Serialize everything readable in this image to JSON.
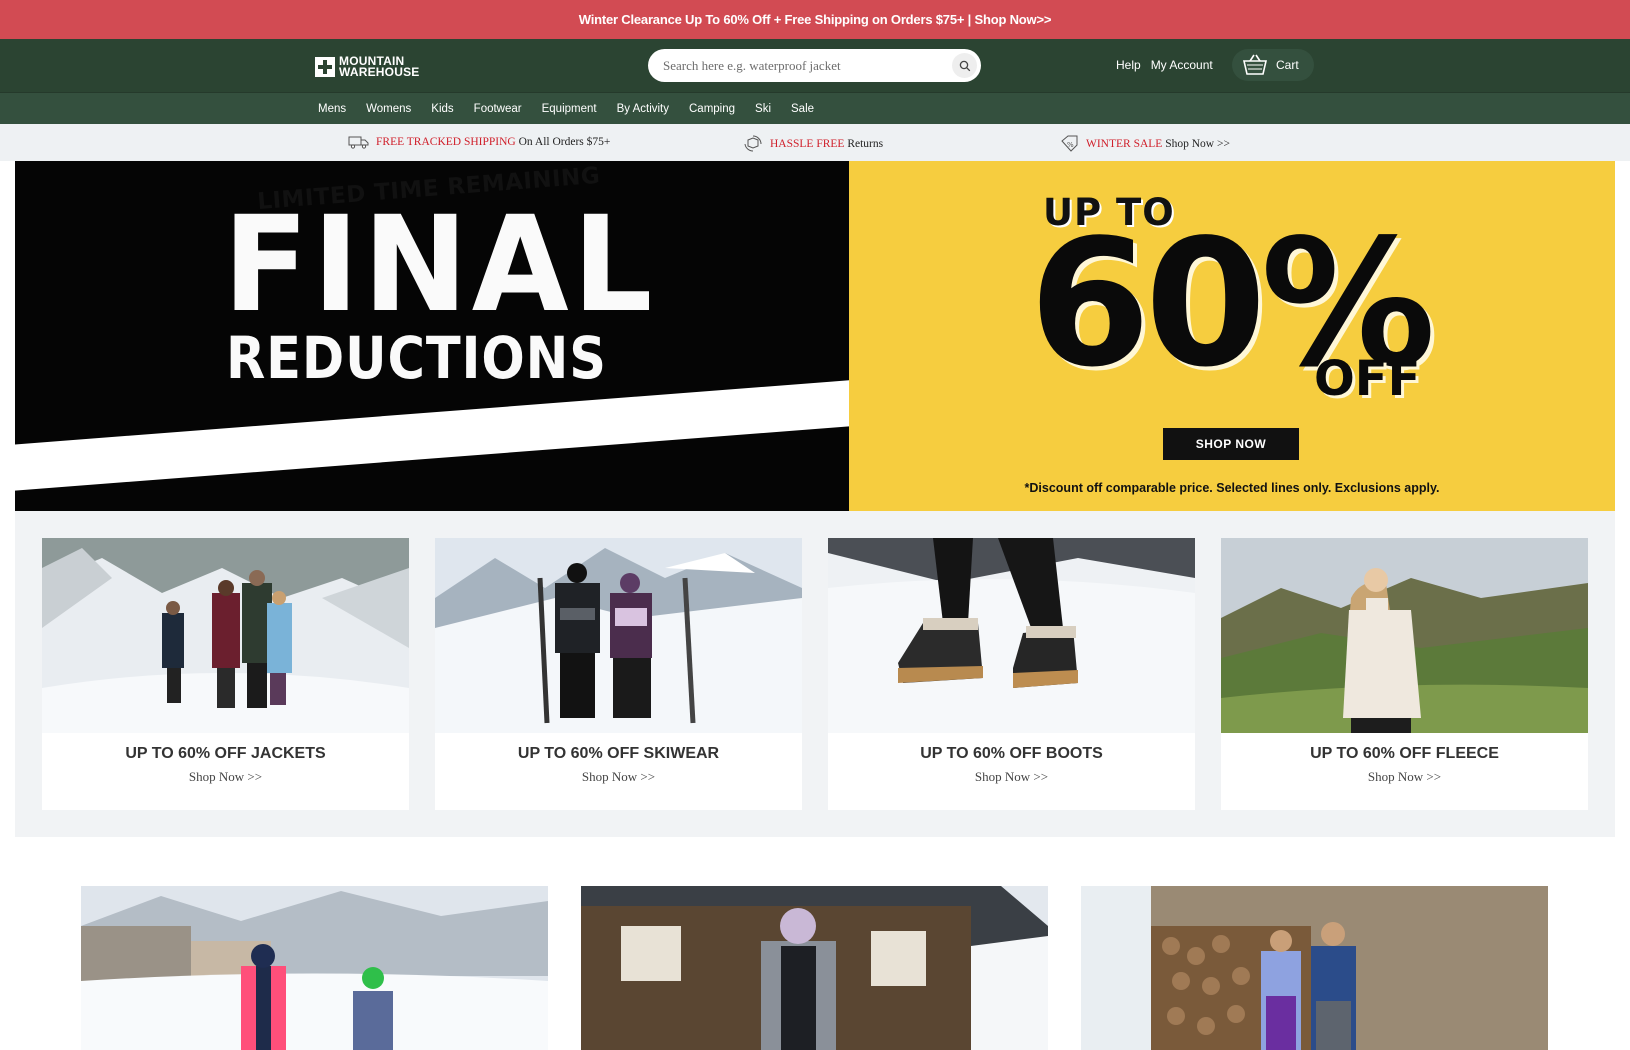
{
  "promo_bar": {
    "text": "Winter Clearance Up To 60% Off + Free Shipping on Orders $75+ | Shop Now>>"
  },
  "header": {
    "logo_line1": "MOUNTAIN",
    "logo_line2": "WAREHOUSE",
    "search_placeholder": "Search here e.g. waterproof jacket",
    "help_label": "Help",
    "account_label": "My Account",
    "cart_label": "Cart"
  },
  "nav": {
    "items": [
      "Mens",
      "Womens",
      "Kids",
      "Footwear",
      "Equipment",
      "By Activity",
      "Camping",
      "Ski",
      "Sale"
    ]
  },
  "usp": {
    "shipping_highlight": "FREE TRACKED SHIPPING",
    "shipping_text": "On All Orders $75+",
    "returns_highlight": "HASSLE FREE",
    "returns_text": "Returns",
    "sale_highlight": "WINTER SALE",
    "sale_text": "Shop Now >>"
  },
  "hero": {
    "headline1": "FINAL",
    "headline2": "REDUCTIONS",
    "ribbon": "LIMITED TIME REMAINING",
    "upto": "UP TO",
    "percent": "60%",
    "off": "OFF",
    "cta": "SHOP NOW",
    "disclaimer": "*Discount off comparable price. Selected lines only. Exclusions apply."
  },
  "categories": [
    {
      "title": "UP TO 60% OFF JACKETS",
      "link": "Shop Now >>"
    },
    {
      "title": "UP TO 60% OFF SKIWEAR",
      "link": "Shop Now >>"
    },
    {
      "title": "UP TO 60% OFF BOOTS",
      "link": "Shop Now >>"
    },
    {
      "title": "UP TO 60% OFF FLEECE",
      "link": "Shop Now >>"
    }
  ],
  "colors": {
    "promo_red": "#d24b53",
    "header_green": "#2b4432",
    "nav_green": "#34503e",
    "hero_yellow": "#f6cd3f",
    "usp_red": "#d0202b"
  }
}
